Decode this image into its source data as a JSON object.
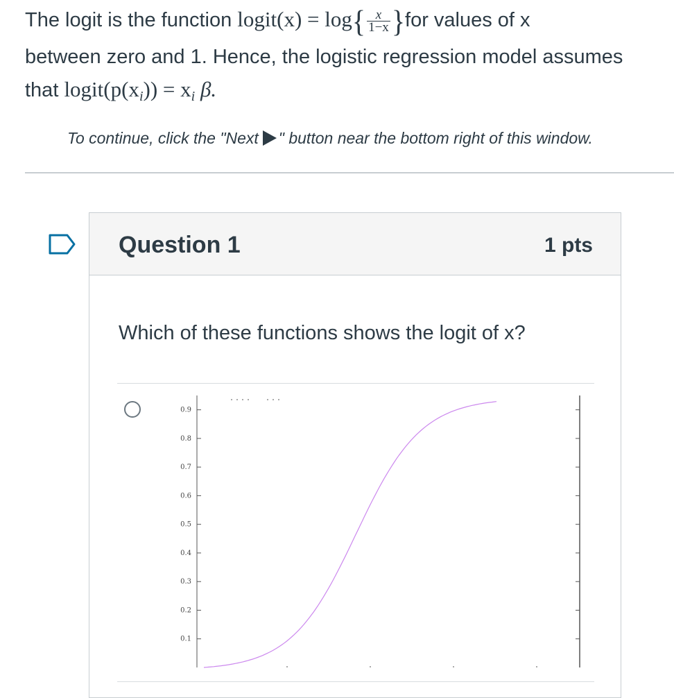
{
  "intro": {
    "line1_prefix": "The logit is the function ",
    "logit_x": "logit(x) = log",
    "frac_num": "x",
    "frac_den": "1−x",
    "line1_suffix": "for values of x",
    "line2": "between zero and 1. Hence, the logistic regression model assumes",
    "line3_prefix": "that ",
    "line3_math": "logit(p(x",
    "line3_sub": "i",
    "line3_math2": ")) = x",
    "line3_math3": "β."
  },
  "continue_text": {
    "before": "To continue, click the \"Next",
    "after": "\" button near the bottom right of this window."
  },
  "question": {
    "title": "Question 1",
    "points": "1 pts",
    "prompt": "Which of these functions shows the logit of x?"
  },
  "chart_data": {
    "type": "line",
    "title": "",
    "xlabel": "",
    "ylabel": "",
    "yticks": [
      "0.9",
      "0.8",
      "0.7",
      "0.6",
      "0.5",
      "0.4",
      "0.3",
      "0.2",
      "0.1"
    ],
    "ylim": [
      0,
      0.95
    ],
    "series": [
      {
        "color": "#cc88ee",
        "shape": "sigmoid",
        "x": [
          0.0,
          0.1,
          0.2,
          0.3,
          0.4,
          0.5,
          0.6,
          0.7,
          0.8,
          0.9,
          1.0
        ],
        "y": [
          0.0,
          0.005,
          0.03,
          0.1,
          0.24,
          0.45,
          0.65,
          0.8,
          0.89,
          0.93,
          0.945
        ]
      }
    ],
    "colors": {
      "curve": "#cc88ee",
      "axis": "#555555"
    }
  },
  "icons": {
    "flag": "flag-icon",
    "radio": "radio-icon"
  }
}
